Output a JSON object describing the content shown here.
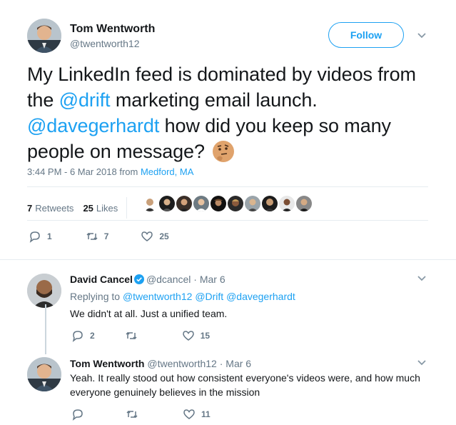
{
  "main_tweet": {
    "author_name": "Tom Wentworth",
    "author_handle": "@twentworth12",
    "follow_label": "Follow",
    "text_1": "My LinkedIn feed is dominated by videos from the ",
    "mention_1": "@drift",
    "text_2": " marketing email launch. ",
    "mention_2": "@davegerhardt",
    "text_3": " how did you keep so many people on message?",
    "emoji": "thinking-face-icon",
    "timestamp": "3:44 PM - 6 Mar 2018 from ",
    "location": "Medford, MA",
    "retweets_count": "7",
    "retweets_label": "Retweets",
    "likes_count": "25",
    "likes_label": "Likes",
    "reply_count": "1",
    "retweet_count": "7",
    "like_count": "25"
  },
  "replies": [
    {
      "author_name": "David Cancel",
      "verified": true,
      "author_handle": "@dcancel",
      "date": "· Mar 6",
      "replying_to_label": "Replying to ",
      "replying_to_1": "@twentworth12",
      "replying_to_2": "@Drift",
      "replying_to_3": "@davegerhardt",
      "text": "We didn't at all. Just a unified team.",
      "reply_count": "2",
      "retweet_count": "",
      "like_count": "15"
    },
    {
      "author_name": "Tom Wentworth",
      "author_handle": "@twentworth12",
      "date": "· Mar 6",
      "text_line1": "Yeah. It really stood out how consistent everyone's videos were, and how much",
      "text_line2": "everyone genuinely believes in the mission",
      "reply_count": "",
      "retweet_count": "",
      "like_count": "11"
    }
  ],
  "colors": {
    "accent": "#1da1f2",
    "text": "#14171a",
    "muted": "#657786",
    "divider": "#e6ecf0"
  },
  "likers": [
    "avatar-1",
    "avatar-2",
    "avatar-3",
    "avatar-4",
    "avatar-5",
    "avatar-6",
    "avatar-7",
    "avatar-8",
    "avatar-9",
    "avatar-10"
  ]
}
